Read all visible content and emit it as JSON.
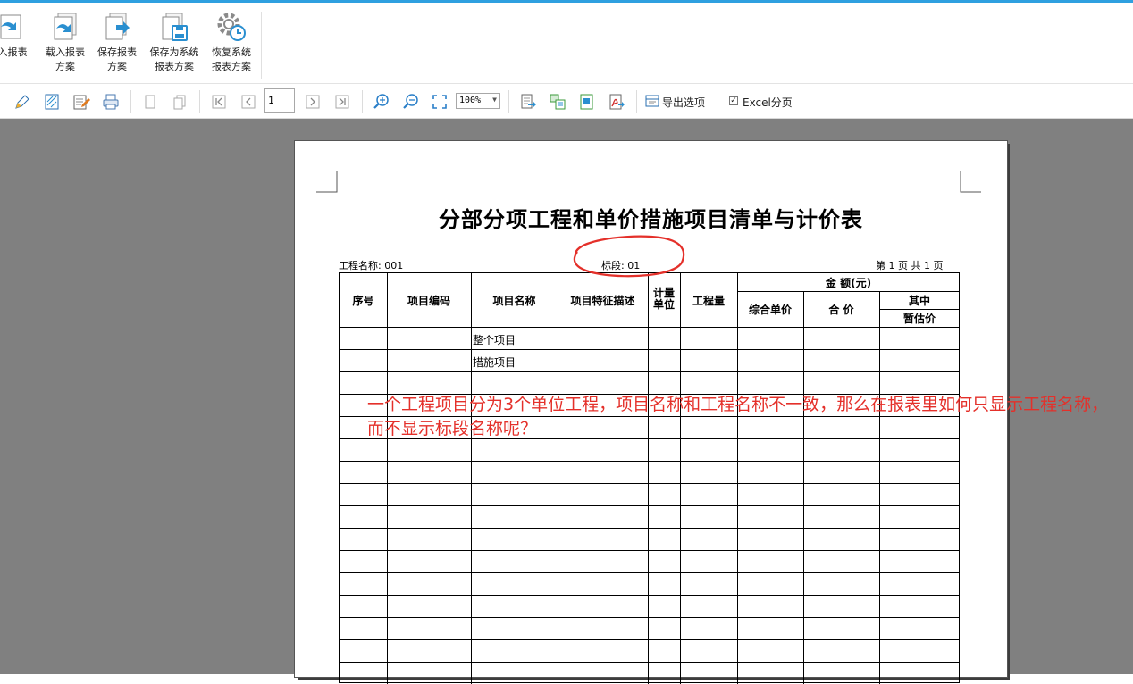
{
  "ribbon": {
    "buttons": [
      {
        "line1": "入报表",
        "line2": "",
        "icon": "load-report-icon"
      },
      {
        "line1": "载入报表",
        "line2": "方案",
        "icon": "load-report-scheme-icon"
      },
      {
        "line1": "保存报表",
        "line2": "方案",
        "icon": "save-report-scheme-icon"
      },
      {
        "line1": "保存为系统",
        "line2": "报表方案",
        "icon": "save-as-system-scheme-icon"
      },
      {
        "line1": "恢复系统",
        "line2": "报表方案",
        "icon": "restore-system-scheme-icon"
      }
    ]
  },
  "toolbar": {
    "page_number": "1",
    "zoom": "100%",
    "export_label": "导出选项",
    "excel_check": "✓",
    "excel_label": "Excel分页"
  },
  "report": {
    "title": "分部分项工程和单价措施项目清单与计价表",
    "project_name": "工程名称: 001",
    "section": "标段: 01",
    "page_info": "第 1 页 共 1 页",
    "headers": {
      "seq": "序号",
      "code": "项目编码",
      "name": "项目名称",
      "feature": "项目特征描述",
      "unit_l1": "计量",
      "unit_l2": "单位",
      "quantity": "工程量",
      "amount": "金 额(元)",
      "unit_price": "综合单价",
      "total": "合 价",
      "of_which": "其中",
      "provisional": "暂估价"
    },
    "rows": [
      {
        "name": "整个项目"
      },
      {
        "name": "措施项目"
      }
    ]
  },
  "annotation": {
    "question": "一个工程项目分为3个单位工程，项目名称和工程名称不一致，那么在报表里如何只显示工程名称，而不显示标段名称呢？"
  },
  "colors": {
    "accent_line": "#2ea0e0",
    "annotation": "#e4302a",
    "workspace": "#808080"
  }
}
